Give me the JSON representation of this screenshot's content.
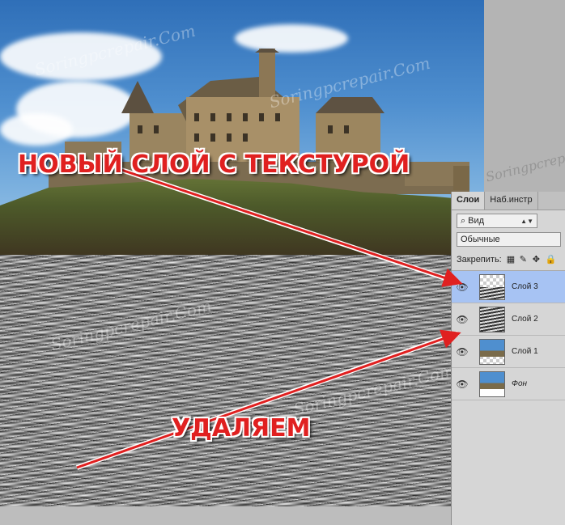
{
  "annotations": {
    "new_layer_label": "НОВЫЙ СЛОЙ С ТЕКСТУРОЙ",
    "delete_label": "УДАЛЯЕМ"
  },
  "watermark": "Soringpcrepair.Com",
  "panel": {
    "tabs": [
      "Слои",
      "Наб.инстр"
    ],
    "filter_value": "Вид",
    "blend_mode": "Обычные",
    "lock_label": "Закрепить:",
    "layers": [
      {
        "name": "Слой 3",
        "selected": true,
        "thumb": "texture-half"
      },
      {
        "name": "Слой 2",
        "selected": false,
        "thumb": "texture"
      },
      {
        "name": "Слой 1",
        "selected": false,
        "thumb": "castle"
      },
      {
        "name": "Фон",
        "selected": false,
        "thumb": "background"
      }
    ]
  },
  "colors": {
    "annotation_red": "#e02020",
    "selected_layer": "#a7c3f3"
  }
}
